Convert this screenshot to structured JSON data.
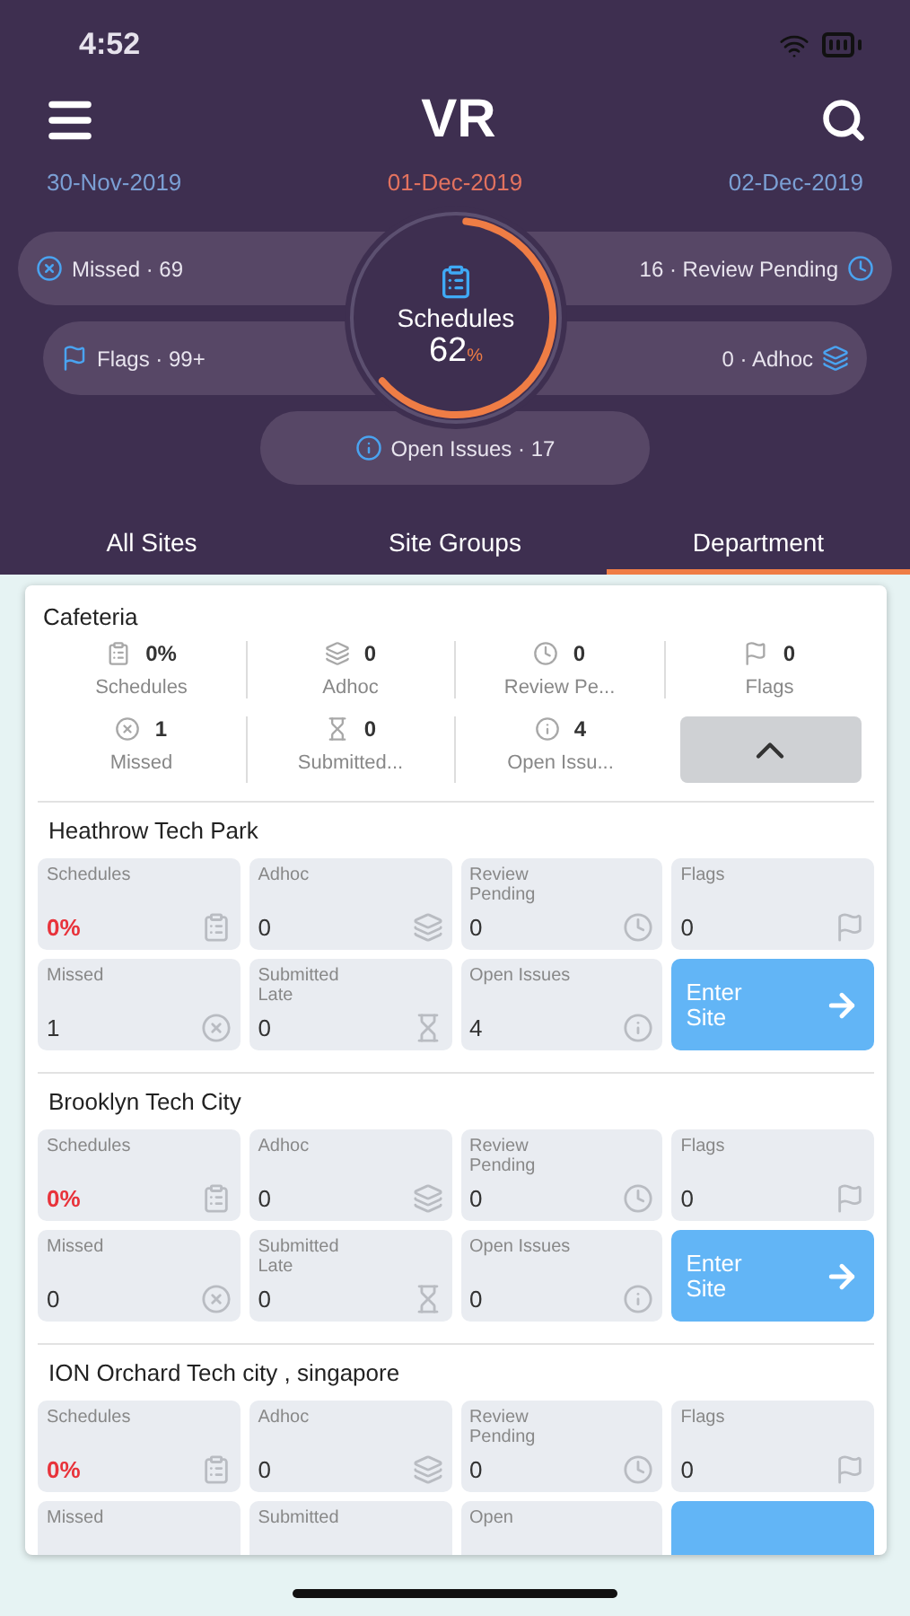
{
  "status_bar": {
    "time": "4:52"
  },
  "header": {
    "title": "VR"
  },
  "dates": [
    {
      "text": "30-Nov-2019",
      "selected": false
    },
    {
      "text": "01-Dec-2019",
      "selected": true
    },
    {
      "text": "02-Dec-2019",
      "selected": false
    }
  ],
  "stat_rows": [
    {
      "left": {
        "kind": "missed",
        "text": "Missed · 69"
      },
      "right": {
        "kind": "review",
        "text": "16 · Review Pending"
      }
    },
    {
      "left": {
        "kind": "flags",
        "text": "Flags · 99+"
      },
      "right": {
        "kind": "adhoc",
        "text": "0 · Adhoc"
      }
    },
    {
      "center": {
        "kind": "issues",
        "text": "Open Issues · 17"
      }
    }
  ],
  "gauge": {
    "label": "Schedules",
    "value": "62",
    "unit": "%",
    "level": 0.62
  },
  "tabs": [
    {
      "label": "All Sites",
      "selected": false
    },
    {
      "label": "Site Groups",
      "selected": false
    },
    {
      "label": "Department",
      "selected": true
    }
  ],
  "department": {
    "name": "Cafeteria",
    "expanded": true,
    "summary": [
      {
        "kind": "schedules",
        "value": "0%",
        "label": "Schedules"
      },
      {
        "kind": "adhoc",
        "value": "0",
        "label": "Adhoc"
      },
      {
        "kind": "review",
        "value": "0",
        "label": "Review Pe..."
      },
      {
        "kind": "flags",
        "value": "0",
        "label": "Flags"
      },
      {
        "kind": "missed",
        "value": "1",
        "label": "Missed"
      },
      {
        "kind": "late",
        "value": "0",
        "label": "Submitted..."
      },
      {
        "kind": "issues",
        "value": "4",
        "label": "Open Issu..."
      }
    ]
  },
  "sites": [
    {
      "name": "Heathrow  Tech Park",
      "enter": "Enter Site",
      "tiles": [
        {
          "kind": "schedules",
          "label": "Schedules",
          "value": "0%"
        },
        {
          "kind": "adhoc",
          "label": "Adhoc",
          "value": "0"
        },
        {
          "kind": "review",
          "label": "Review Pending",
          "value": "0"
        },
        {
          "kind": "flags",
          "label": "Flags",
          "value": "0"
        },
        {
          "kind": "missed",
          "label": "Missed",
          "value": "1"
        },
        {
          "kind": "late",
          "label": "Submitted Late",
          "value": "0"
        },
        {
          "kind": "issues",
          "label": "Open Issues",
          "value": "4"
        }
      ]
    },
    {
      "name": "Brooklyn Tech City",
      "enter": "Enter Site",
      "tiles": [
        {
          "kind": "schedules",
          "label": "Schedules",
          "value": "0%"
        },
        {
          "kind": "adhoc",
          "label": "Adhoc",
          "value": "0"
        },
        {
          "kind": "review",
          "label": "Review Pending",
          "value": "0"
        },
        {
          "kind": "flags",
          "label": "Flags",
          "value": "0"
        },
        {
          "kind": "missed",
          "label": "Missed",
          "value": "0"
        },
        {
          "kind": "late",
          "label": "Submitted Late",
          "value": "0"
        },
        {
          "kind": "issues",
          "label": "Open Issues",
          "value": "0"
        }
      ]
    },
    {
      "name": "ION Orchard Tech city , singapore",
      "tiles": [
        {
          "kind": "schedules",
          "label": "Schedules",
          "value": "0%"
        },
        {
          "kind": "adhoc",
          "label": "Adhoc",
          "value": "0"
        },
        {
          "kind": "review",
          "label": "Review Pending",
          "value": "0"
        },
        {
          "kind": "flags",
          "label": "Flags",
          "value": "0"
        },
        {
          "label": "Missed"
        },
        {
          "label": "Submitted"
        },
        {
          "label": "Open"
        }
      ]
    }
  ]
}
